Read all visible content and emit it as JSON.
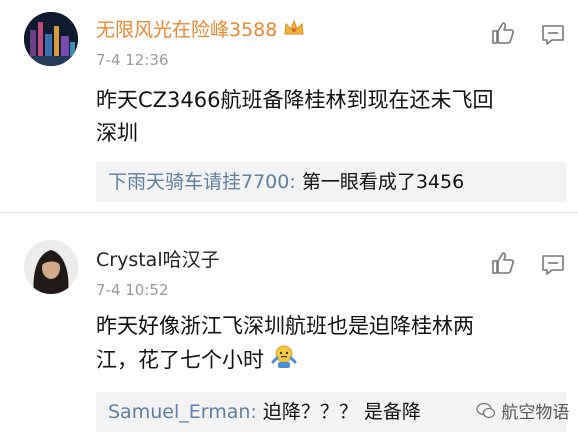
{
  "comments": [
    {
      "username": "无限风光在险峰3588",
      "time": "7-4 12:36",
      "body_line1": "昨天CZ3466航班备降桂林到现在还未飞回",
      "body_line2": "深圳",
      "reply_user": "下雨天骑车请挂7700",
      "reply_sep": ":",
      "reply_text": "第一眼看成了3456"
    },
    {
      "username": "Crystal哈汉子",
      "time": "7-4 10:52",
      "body_line1": "昨天好像浙江飞深圳航班也是迫降桂林两",
      "body_line2": "江，花了七个小时",
      "reply_user": "Samuel_Erman",
      "reply_sep": ":",
      "reply_text": "迫降？？？ 是备降"
    }
  ],
  "watermark": "航空物语",
  "icons": [
    "thumbs-up-icon",
    "comment-icon",
    "vip-crown-icon",
    "shrug-emoji-icon",
    "wechat-icon"
  ],
  "colors": {
    "username_vip": "#e8882c",
    "username_normal": "#222222",
    "reply_user": "#5f7f9f",
    "time": "#9a9a9a"
  }
}
